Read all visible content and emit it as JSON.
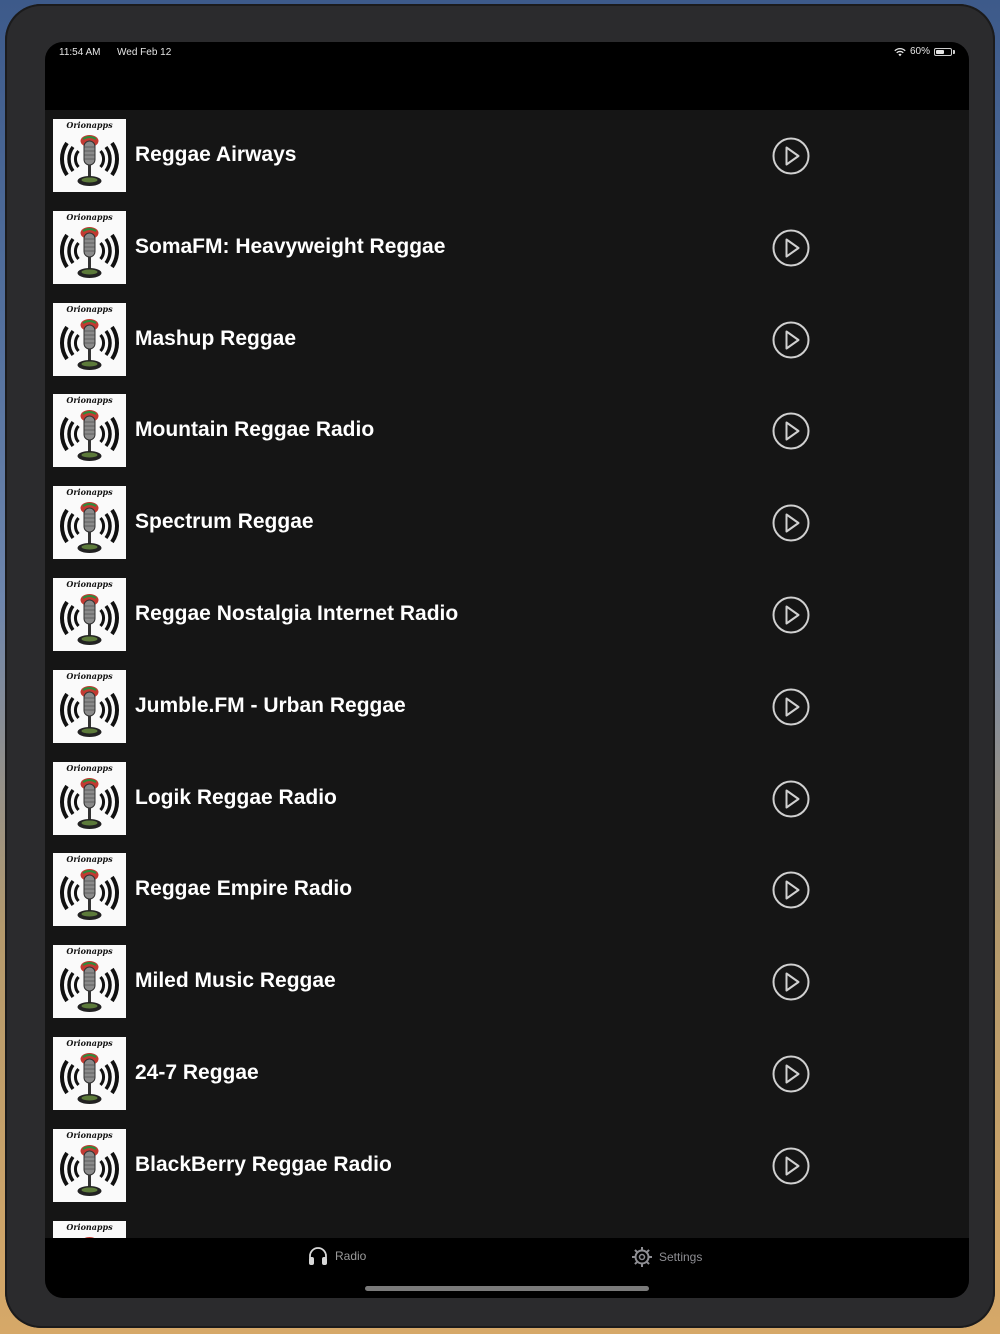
{
  "status_bar": {
    "time": "11:54 AM",
    "date": "Wed Feb 12",
    "battery": "60%",
    "battery_level": 0.6
  },
  "thumbnail_text": "Orionapps",
  "stations": [
    {
      "name": "Reggae Airways"
    },
    {
      "name": "SomaFM: Heavyweight Reggae"
    },
    {
      "name": "Mashup Reggae"
    },
    {
      "name": "Mountain Reggae Radio"
    },
    {
      "name": "Spectrum Reggae"
    },
    {
      "name": "Reggae Nostalgia Internet Radio"
    },
    {
      "name": "Jumble.FM - Urban Reggae"
    },
    {
      "name": "Logik Reggae Radio"
    },
    {
      "name": "Reggae Empire Radio"
    },
    {
      "name": "Miled Music Reggae"
    },
    {
      "name": "24-7 Reggae"
    },
    {
      "name": "BlackBerry Reggae Radio"
    },
    {
      "name": ""
    }
  ],
  "tabs": {
    "radio": {
      "label": "Radio",
      "icon": "headphones-icon"
    },
    "settings": {
      "label": "Settings",
      "icon": "gear-icon"
    }
  },
  "colors": {
    "background": "#151515",
    "bars": "#000000",
    "text": "#ffffff",
    "tab_inactive": "#8e8e93"
  }
}
